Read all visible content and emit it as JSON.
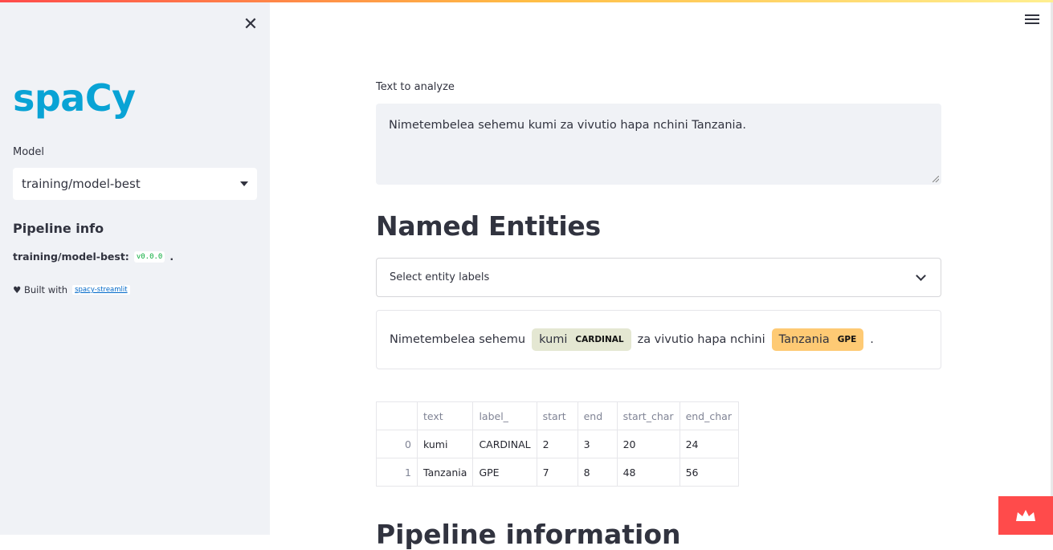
{
  "sidebar": {
    "logo": "spaCy",
    "model_label": "Model",
    "model_value": "training/model-best",
    "pipeline_heading": "Pipeline info",
    "pipeline_name": "training/model-best:",
    "pipeline_version": "v0.0.0",
    "pipeline_suffix": ".",
    "built_with": "♥ Built with",
    "built_link": "spacy-streamlit"
  },
  "main": {
    "text_label": "Text to analyze",
    "text_value": "Nimetembelea sehemu kumi za vivutio hapa nchini Tanzania.",
    "ner_heading": "Named Entities",
    "entity_select_placeholder": "Select entity labels",
    "entities_render": {
      "t1": "Nimetembelea sehemu",
      "e1_text": "kumi",
      "e1_label": "CARDINAL",
      "t2": "za vivutio hapa nchini",
      "e2_text": "Tanzania",
      "e2_label": "GPE",
      "t3": "."
    },
    "table": {
      "columns": [
        "",
        "text",
        "label_",
        "start",
        "end",
        "start_char",
        "end_char"
      ],
      "rows": [
        [
          "0",
          "kumi",
          "CARDINAL",
          "2",
          "3",
          "20",
          "24"
        ],
        [
          "1",
          "Tanzania",
          "GPE",
          "7",
          "8",
          "48",
          "56"
        ]
      ]
    },
    "next_heading": "Pipeline information"
  },
  "colors": {
    "accent": "#ff4b4b",
    "logo": "#09a3d5",
    "cardinal": "#e4e7d2",
    "gpe": "#feca74"
  }
}
